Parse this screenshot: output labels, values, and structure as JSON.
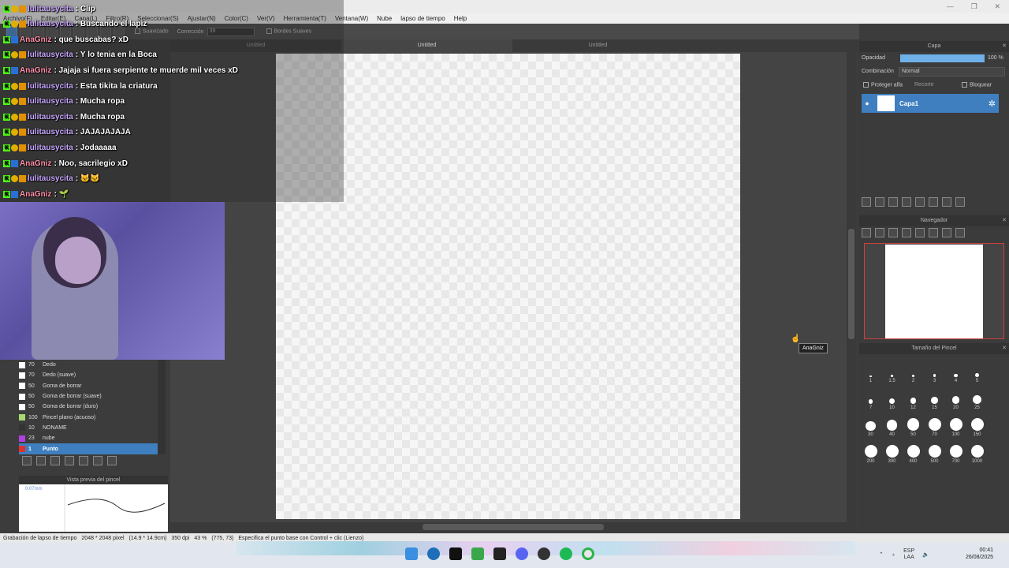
{
  "titlebar": {
    "minimize": "—",
    "restore": "❐",
    "close": "✕"
  },
  "menu": [
    "Archivo(F)",
    "Editar(E)",
    "Capa(L)",
    "Filtro(R)",
    "Seleccionar(S)",
    "Ajustar(N)",
    "Color(C)",
    "Ver(V)",
    "Herramienta(T)",
    "Ventana(W)",
    "Nube",
    "lapso de tiempo",
    "Help"
  ],
  "toolbar": {
    "stabilizer": "Suavizado",
    "correction_label": "Corrección",
    "correction_value": "39",
    "bordes": "Bordes Suaves"
  },
  "tabs": [
    "Untitled",
    "Untitled",
    "Untitled"
  ],
  "chat": [
    {
      "user": "lulitausycita",
      "msg": "Clip"
    },
    {
      "user": "lulitausycita",
      "msg": "Buscando el lapiz"
    },
    {
      "user": "AnaGniz",
      "msg": "que buscabas? xD"
    },
    {
      "user": "lulitausycita",
      "msg": "Y lo tenia en la Boca"
    },
    {
      "user": "AnaGniz",
      "msg": "Jajaja si fuera serpiente te muerde mil veces xD"
    },
    {
      "user": "lulitausycita",
      "msg": "Esta tikita la criatura"
    },
    {
      "user": "lulitausycita",
      "msg": "Mucha ropa"
    },
    {
      "user": "lulitausycita",
      "msg": "Mucha ropa"
    },
    {
      "user": "lulitausycita",
      "msg": "JAJAJAJAJA"
    },
    {
      "user": "lulitausycita",
      "msg": "Jodaaaaa"
    },
    {
      "user": "AnaGniz",
      "msg": "Noo, sacrilegio xD"
    },
    {
      "user": "lulitausycita",
      "msg": "🐱🐱"
    },
    {
      "user": "AnaGniz",
      "msg": "🌱"
    }
  ],
  "layer_panel": {
    "title": "Capa",
    "opacity_label": "Opacidad",
    "opacity_value": "100 %",
    "opacity_level": 1.0,
    "blend_label": "Combinación",
    "blend_value": "Normal",
    "protect": "Proteger alfa",
    "clip": "Recorte",
    "lock": "Bloquear",
    "layer_name": "Capa1"
  },
  "navigator": {
    "title": "Navegador"
  },
  "brush_size": {
    "title": "Tamaño del Pincel",
    "sizes": [
      "1",
      "1.5",
      "2",
      "3",
      "4",
      "5",
      "7",
      "10",
      "12",
      "15",
      "20",
      "25",
      "30",
      "40",
      "50",
      "70",
      "100",
      "150",
      "200",
      "300",
      "400",
      "500",
      "700",
      "1000"
    ]
  },
  "brushes": [
    {
      "size": "70",
      "name": "Dedo",
      "color": "#ffffff"
    },
    {
      "size": "70",
      "name": "Dedo (suave)",
      "color": "#ffffff"
    },
    {
      "size": "50",
      "name": "Goma de borrar",
      "color": "#ffffff"
    },
    {
      "size": "50",
      "name": "Goma de borrar (suave)",
      "color": "#ffffff"
    },
    {
      "size": "50",
      "name": "Goma de borrar (duro)",
      "color": "#ffffff"
    },
    {
      "size": "100",
      "name": "Pincel plano (acuoso)",
      "color": "#a8d870"
    },
    {
      "size": "10",
      "name": "NONAME",
      "color": "#333333"
    },
    {
      "size": "23",
      "name": "nube",
      "color": "#b040e0"
    },
    {
      "size": "1",
      "name": "Punto",
      "color": "#e03030",
      "selected": true
    }
  ],
  "brush_preview": {
    "title": "Vista previa del pincel",
    "value": "0.07mm"
  },
  "tooltip": "AnaGniz",
  "status": [
    "Grabación de lapso de tiempo",
    "2048 * 2048 pixel",
    "(14.9 * 14.9cm)",
    "350 dpi",
    "43 %",
    "(775, 73)",
    "Especifica el punto base con Control + clic (Lienzo)"
  ],
  "tray": {
    "lang": "ESP",
    "lang2": "LAA",
    "time": "00:41",
    "date": "26/08/2025"
  },
  "colors": {
    "accent": "#3f7fbf",
    "kick": "#53fc18"
  }
}
